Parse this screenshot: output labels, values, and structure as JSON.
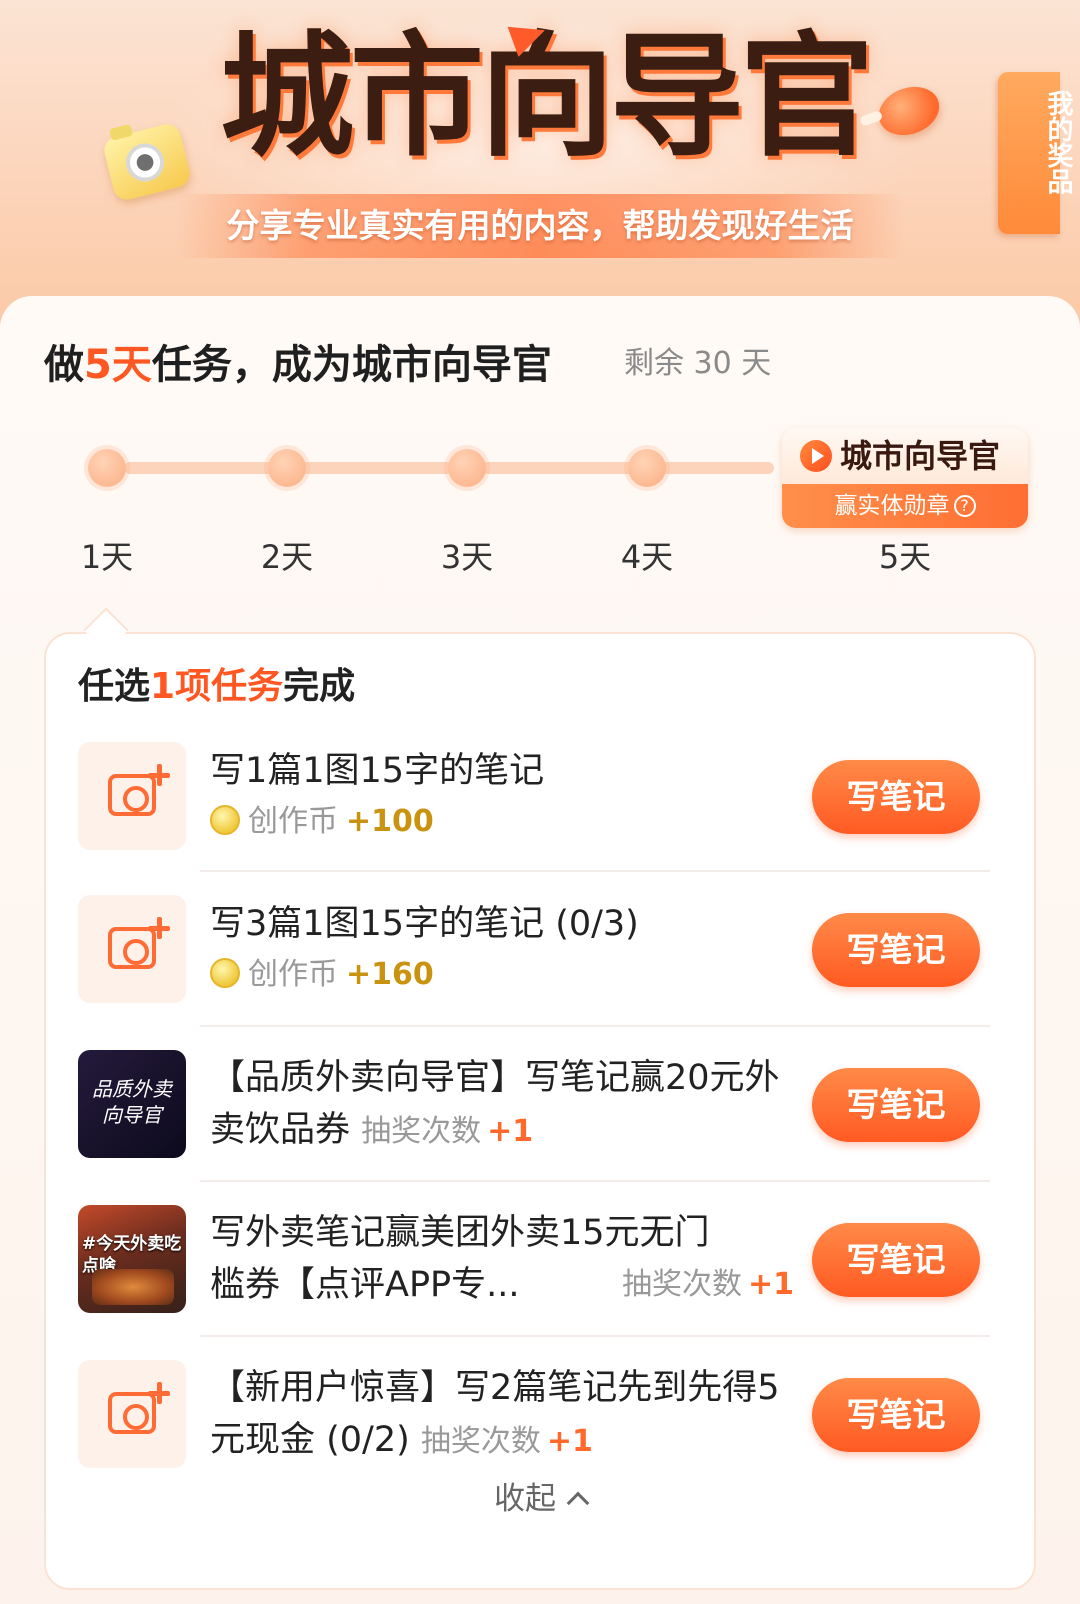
{
  "banner": {
    "title": "城市向导官",
    "subtitle": "分享专业真实有用的内容，帮助发现好生活",
    "prize_tab": "我的奖品"
  },
  "headline": {
    "prefix": "做",
    "days": "5天",
    "suffix": "任务，成为城市向导官",
    "remaining": "剩余 30 天"
  },
  "progress": {
    "days": [
      "1天",
      "2天",
      "3天",
      "4天",
      "5天"
    ],
    "badge_title": "城市向导官",
    "badge_sub": "赢实体勋章"
  },
  "tasks": {
    "heading_prefix": "任选",
    "heading_accent": "1项任务",
    "heading_suffix": "完成",
    "items": [
      {
        "title": "写1篇1图15字的笔记",
        "meta_label": "创作币",
        "meta_value": "+100",
        "button": "写笔记"
      },
      {
        "title": "写3篇1图15字的笔记 (0/3)",
        "meta_label": "创作币",
        "meta_value": "+160",
        "button": "写笔记"
      },
      {
        "title": "【品质外卖向导官】写笔记赢20元外卖饮品券",
        "meta_label": "抽奖次数",
        "meta_value": "+1",
        "button": "写笔记",
        "thumb_text": "品质外卖向导官"
      },
      {
        "title_line1": "写外卖笔记赢美团外卖15元无门",
        "title_line2": "槛券【点评APP专...",
        "meta_label": "抽奖次数",
        "meta_value": "+1",
        "button": "写笔记",
        "thumb_text": "#今天外卖吃点啥"
      },
      {
        "title": "【新用户惊喜】写2篇笔记先到先得5元现金 (0/2)",
        "meta_label": "抽奖次数",
        "meta_value": "+1",
        "button": "写笔记"
      }
    ],
    "collapse": "收起"
  },
  "colors": {
    "accent": "#ff5722",
    "button": "#ff6a2c",
    "coin_value": "#c9920f"
  }
}
